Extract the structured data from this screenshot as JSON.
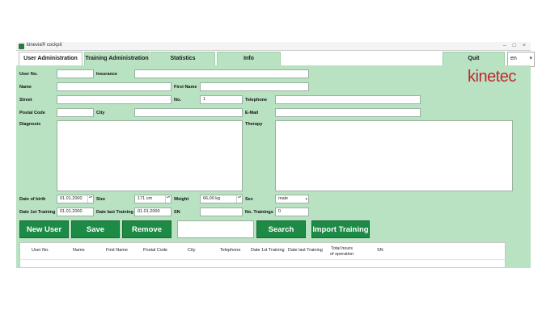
{
  "window": {
    "title": "kinevia® cockpit",
    "controls": "– □ ×"
  },
  "tabs": [
    "User Administration",
    "Training Administration",
    "Statistics",
    "Info"
  ],
  "quit_label": "Quit",
  "language": {
    "value": "en",
    "arrow": "▾"
  },
  "logo_text": "kinetec",
  "form": {
    "user_no": "User No.",
    "insurance": "Insurance",
    "name": "Name",
    "first_name": "First Name",
    "street": "Street",
    "no": "No.",
    "no_value": "1",
    "telephone": "Telephone",
    "postal_code": "Postal Code",
    "city": "City",
    "email": "E-Mail",
    "diagnosis": "Diagnosis",
    "therapy": "Therapy",
    "date_of_birth": "Date of birth",
    "date_of_birth_value": "01.01.2000",
    "size": "Size",
    "size_value": "171 cm",
    "weight": "Weight",
    "weight_value": "66,00 kg",
    "sex": "Sex",
    "sex_value": "male",
    "date_1st_training": "Date 1st Training",
    "date_1st_training_value": "01.01.2000",
    "date_last_training": "Date last Training",
    "date_last_training_value": "01.01.2000",
    "sn": "SN",
    "no_trainings": "No. Trainings",
    "no_trainings_value": "0"
  },
  "buttons": {
    "new_user": "New User",
    "save": "Save",
    "remove": "Remove",
    "search": "Search",
    "import_training": "Import Training"
  },
  "table": {
    "columns": [
      "User No.",
      "Name",
      "First Name",
      "Postal Code",
      "City",
      "Telephone",
      "Date 1st Training",
      "Date last Training",
      "Total hours\nof operation",
      "SN"
    ]
  },
  "colors": {
    "panel": "#b9e2c2",
    "button": "#1d8a45",
    "logo": "#c0272d"
  },
  "icons": {
    "spinner": "▴▾",
    "dropdown": "▾"
  }
}
